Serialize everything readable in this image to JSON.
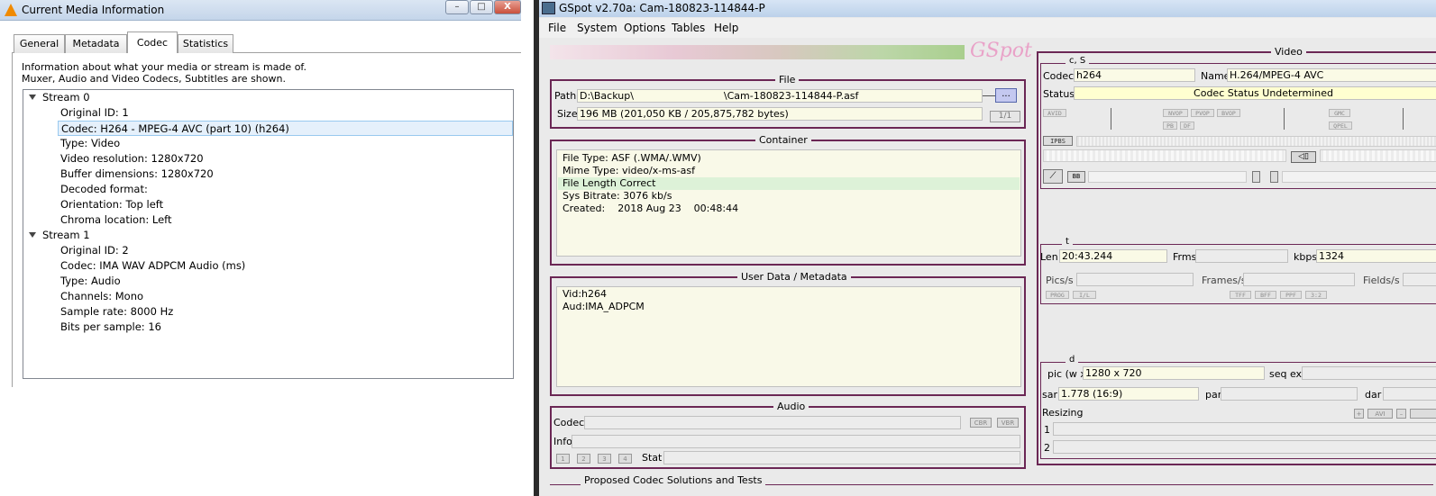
{
  "vlc": {
    "title": "Current Media Information",
    "controls": {
      "min": "–",
      "max": "□",
      "close": "X"
    },
    "tabs": [
      "General",
      "Metadata",
      "Codec",
      "Statistics"
    ],
    "active_tab": "Codec",
    "desc_line1": "Information about what your media or stream is made of.",
    "desc_line2": "Muxer, Audio and Video Codecs, Subtitles are shown.",
    "streams": [
      {
        "name": "Stream 0",
        "items": [
          "Original ID: 1",
          "Codec: H264 - MPEG-4 AVC (part 10) (h264)",
          "Type: Video",
          "Video resolution: 1280x720",
          "Buffer dimensions: 1280x720",
          "Decoded format:",
          "Orientation: Top left",
          "Chroma location: Left"
        ]
      },
      {
        "name": "Stream 1",
        "items": [
          "Original ID: 2",
          "Codec: IMA WAV ADPCM Audio (ms)",
          "Type: Audio",
          "Channels: Mono",
          "Sample rate: 8000 Hz",
          "Bits per sample: 16"
        ]
      }
    ]
  },
  "gspot": {
    "title": "GSpot v2.70a: Cam-180823-114844-P",
    "menu": [
      "File",
      "System",
      "Options",
      "Tables",
      "Help"
    ],
    "logo": "GSpot",
    "file": {
      "title": "File",
      "path_label": "Path",
      "path_value": "D:\\Backup\\",
      "path_value2": "\\Cam-180823-114844-P.asf",
      "browse": "...",
      "size_label": "Size",
      "size_value": "196 MB (201,050 KB / 205,875,782 bytes)",
      "page": "1/1"
    },
    "container": {
      "title": "Container",
      "lines": [
        "File Type: ASF (.WMA/.WMV)",
        "Mime Type: video/x-ms-asf",
        "File Length Correct",
        "Sys Bitrate: 3076 kb/s",
        "Created:    2018 Aug 23    00:48:44"
      ]
    },
    "userdata": {
      "title": "User Data / Metadata",
      "lines": [
        "Vid:h264",
        "Aud:IMA_ADPCM"
      ]
    },
    "audio": {
      "title": "Audio",
      "codec_label": "Codec",
      "info_label": "Info",
      "cbr": "CBR",
      "vbr": "VBR",
      "nums": [
        "1",
        "2",
        "3",
        "4"
      ],
      "stat_label": "Stat"
    },
    "proposed": {
      "title": "Proposed Codec Solutions and Tests"
    },
    "video": {
      "title": "Video",
      "cs_title": "c, S",
      "codec_label": "Codec",
      "codec_value": "h264",
      "name_label": "Name",
      "name_value": "H.264/MPEG-4 AVC",
      "status_label": "Status",
      "status_value": "Codec Status Undetermined",
      "flags": [
        "AVID",
        "NVOP",
        "PVOP",
        "BVOP",
        "GMC",
        "PB",
        "DF",
        "QPEL"
      ],
      "ipbs": "IPBS",
      "bb": "BB",
      "t_title": "t",
      "len_label": "Len",
      "len_value": "20:43.244",
      "frms_label": "Frms",
      "kbps_label": "kbps",
      "kbps_value": "1324",
      "pics_label": "Pics/s",
      "frames_label": "Frames/s",
      "fields_label": "Fields/s",
      "flags2": [
        "PROG",
        "I/L",
        "TFF",
        "BFF",
        "PPF",
        "3:2"
      ],
      "d_title": "d",
      "pic_label": "pic (w x",
      "pic_value": "1280 x 720",
      "seqext_label": "seq ext",
      "sar_label": "sar",
      "sar_value": "1.778 (16:9)",
      "par_label": "par",
      "dar_label": "dar",
      "resizing_label": "Resizing",
      "resize_row1": "1",
      "resize_row2": "2",
      "resize_btns": [
        "+",
        "AVI",
        "–"
      ]
    }
  }
}
